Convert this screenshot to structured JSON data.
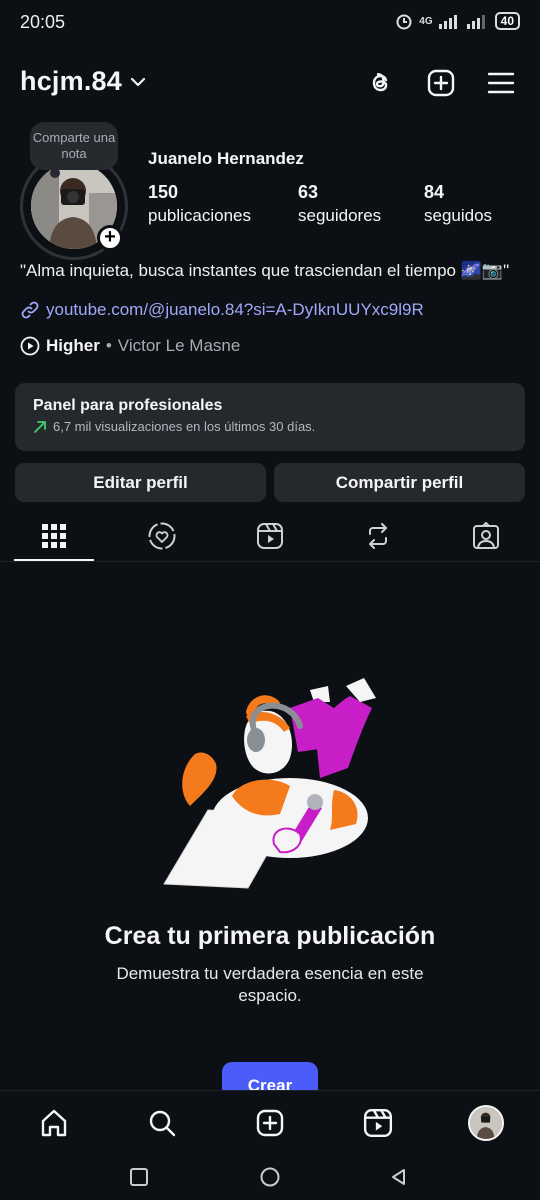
{
  "status_bar": {
    "time": "20:05",
    "network": "4G",
    "battery": "40"
  },
  "header": {
    "username": "hcjm.84",
    "icons": [
      "threads-icon",
      "create-icon",
      "menu-icon"
    ]
  },
  "profile": {
    "note": "Comparte una nota",
    "full_name": "Juanelo Hernandez",
    "stats": [
      {
        "value": "150",
        "label": "publicaciones"
      },
      {
        "value": "63",
        "label": "seguidores"
      },
      {
        "value": "84",
        "label": "seguidos"
      }
    ],
    "bio": "\"Alma inquieta, busca instantes que trasciendan el tiempo 🌌📷\"",
    "link": "youtube.com/@juanelo.84?si=A-DyIknUUYxc9l9R",
    "music": {
      "song": "Higher",
      "separator": " • ",
      "artist": "Victor Le Masne"
    }
  },
  "panel": {
    "title": "Panel para profesionales",
    "subtitle": "6,7 mil visualizaciones en los últimos 30 días."
  },
  "buttons": {
    "edit": "Editar perfil",
    "share": "Compartir perfil"
  },
  "tabs": [
    "grid-icon",
    "heart-story-icon",
    "reels-icon",
    "reposts-icon",
    "tagged-icon"
  ],
  "empty_state": {
    "title": "Crea tu primera publicación",
    "subtitle": "Demuestra tu verdadera esencia en este espacio.",
    "cta": "Crear"
  },
  "bottom_nav": [
    "home-icon",
    "search-icon",
    "create-icon",
    "reels-icon",
    "profile-avatar"
  ],
  "colors": {
    "background": "#0c1014",
    "card": "#25292e",
    "link": "#a0a8f8",
    "primary": "#4a5df9",
    "accent_orange": "#f57a1c",
    "accent_magenta": "#c81ec8"
  }
}
